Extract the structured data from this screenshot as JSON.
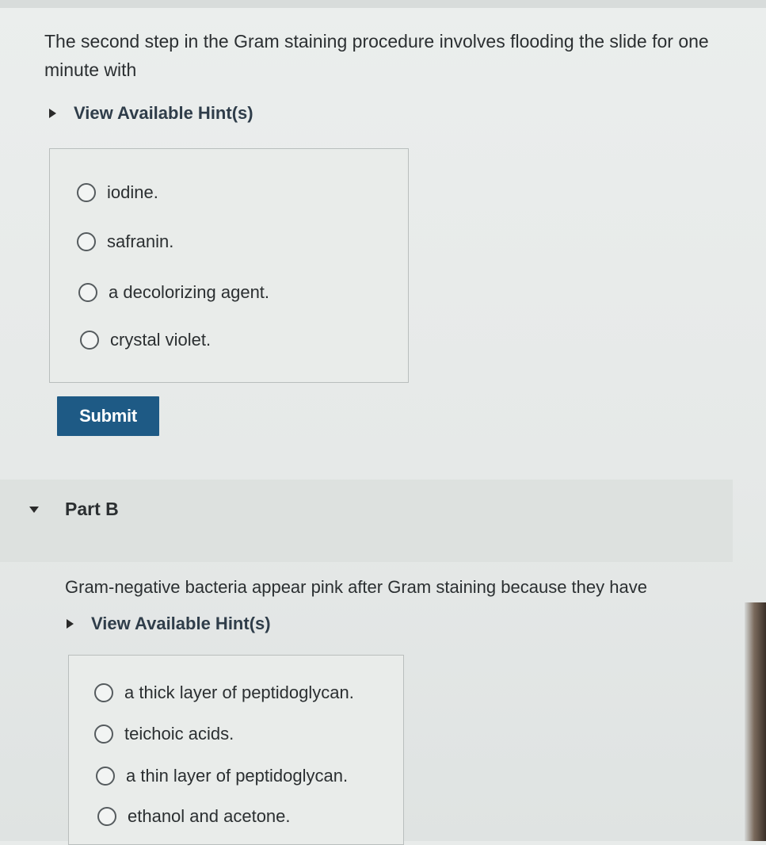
{
  "part_a": {
    "question": "The second step in the Gram staining procedure involves flooding the slide for one minute with",
    "hint_label": "View Available Hint(s)",
    "options": [
      "iodine.",
      "safranin.",
      "a decolorizing agent.",
      "crystal violet."
    ],
    "submit_label": "Submit"
  },
  "part_b": {
    "title": "Part B",
    "question": "Gram-negative bacteria appear pink after Gram staining because they have",
    "hint_label": "View Available Hint(s)",
    "options": [
      "a thick layer of peptidoglycan.",
      "teichoic acids.",
      "a thin layer of peptidoglycan.",
      "ethanol and acetone."
    ]
  },
  "colors": {
    "submit_background": "#1e5a85",
    "part_header_background": "#dde1df"
  }
}
